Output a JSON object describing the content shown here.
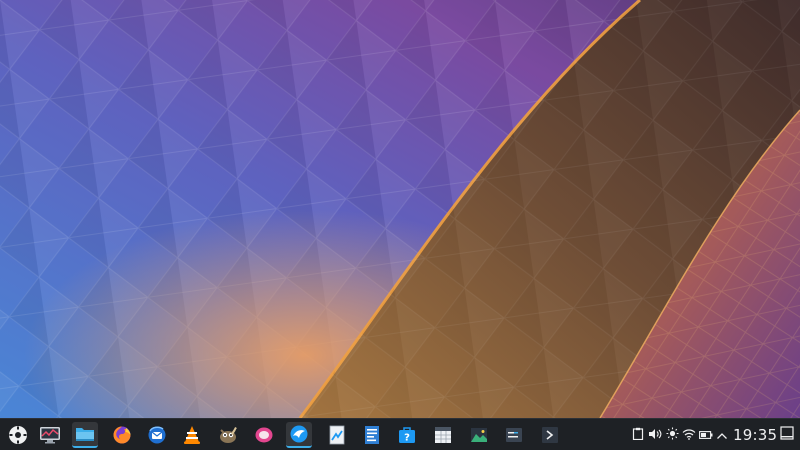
{
  "desktop": {
    "wallpaper": "plasma-geometric",
    "colors": {
      "blue": "#4e7fd2",
      "purple": "#6a4fa8",
      "orange": "#d98a3a",
      "brown": "#6f4e34"
    }
  },
  "taskbar": {
    "background": "#1e2125",
    "accent": "#3daee9",
    "launcher_icon": "application-launcher-icon",
    "apps": [
      {
        "icon": "system-monitor-icon"
      },
      {
        "icon": "file-manager-icon"
      },
      {
        "icon": "firefox-icon"
      },
      {
        "icon": "thunderbird-icon"
      },
      {
        "icon": "vlc-icon"
      },
      {
        "icon": "gimp-icon"
      },
      {
        "icon": "audio-player-icon"
      },
      {
        "icon": "web-browser-icon"
      },
      {
        "icon": "document-viewer-icon"
      },
      {
        "icon": "text-editor-icon"
      },
      {
        "icon": "help-center-icon"
      },
      {
        "icon": "spreadsheet-icon"
      },
      {
        "icon": "image-viewer-icon"
      },
      {
        "icon": "terminal-icon"
      },
      {
        "icon": "konsole-icon"
      }
    ],
    "tray": {
      "icons": [
        "clipboard-icon",
        "volume-icon",
        "brightness-icon",
        "wifi-icon",
        "battery-icon",
        "expand-tray-icon"
      ],
      "clock": "19:35",
      "show_desktop_icon": "show-desktop-icon"
    }
  }
}
